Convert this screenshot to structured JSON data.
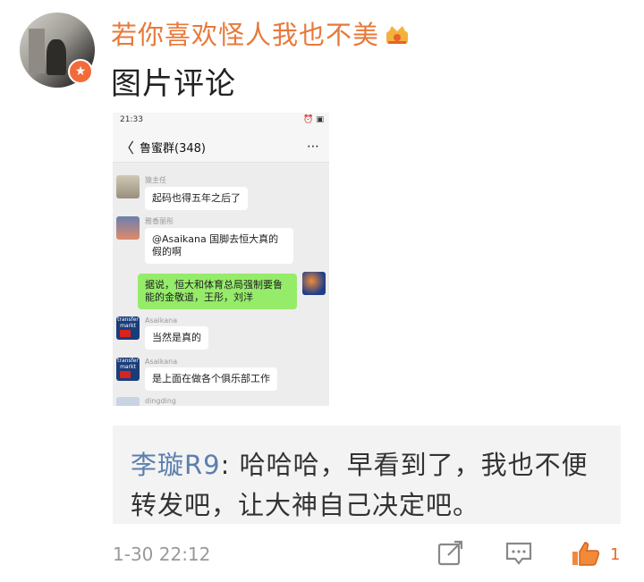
{
  "post": {
    "username": "若你喜欢怪人我也不美",
    "comment_type": "图片评论",
    "crown_icon": "crown-icon",
    "badge_icon": "verified-badge-icon"
  },
  "screenshot": {
    "status_time": "21:33",
    "status_icons": "⏰ ▣",
    "back_glyph": "〈",
    "group_title": "鲁蜜群(348)",
    "more_glyph": "⋯",
    "messages": [
      {
        "name": "猿主任",
        "text": "起码也得五年之后了"
      },
      {
        "name": "雅香丽彤",
        "text": "@Asaikana 国脚去恒大真的假的啊"
      },
      {
        "name": "",
        "text": "据说，恒大和体育总局强制要鲁能的金敬道，王彤，刘洋"
      },
      {
        "name": "Asaikana",
        "text": "当然是真的"
      },
      {
        "name": "Asaikana",
        "text": "是上面在做各个俱乐部工作"
      },
      {
        "name": "dingding",
        "text": ""
      }
    ],
    "logo_text": "transfer markt"
  },
  "reply": {
    "author": "李璇R9",
    "text": ": 哈哈哈，早看到了，我也不便转发吧，让大神自己决定吧。"
  },
  "footer": {
    "timestamp": "1-30 22:12",
    "like_count": "1",
    "share_icon": "share-icon",
    "comment_icon": "comment-icon",
    "like_icon": "thumbs-up-icon",
    "accent_color": "#e86a2b"
  }
}
